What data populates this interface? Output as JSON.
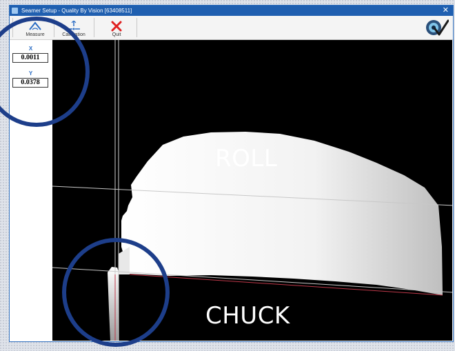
{
  "window": {
    "title": "Seamer Setup - Quality By Vision [63408511]",
    "close_label": "✕"
  },
  "toolbar": {
    "measure_label": "Measure",
    "calibration_label": "Calibration",
    "quit_label": "Quit"
  },
  "coords": {
    "x_label": "X",
    "x_value": "0.0011",
    "y_label": "Y",
    "y_value": "0.0378"
  },
  "image_labels": {
    "roll": "ROLL",
    "chuck": "CHUCK"
  },
  "colors": {
    "titlebar": "#1f5fb0",
    "annotation_circle": "#1d3e8a",
    "quit_icon": "#e02020",
    "tool_icon": "#2a6cc4"
  }
}
